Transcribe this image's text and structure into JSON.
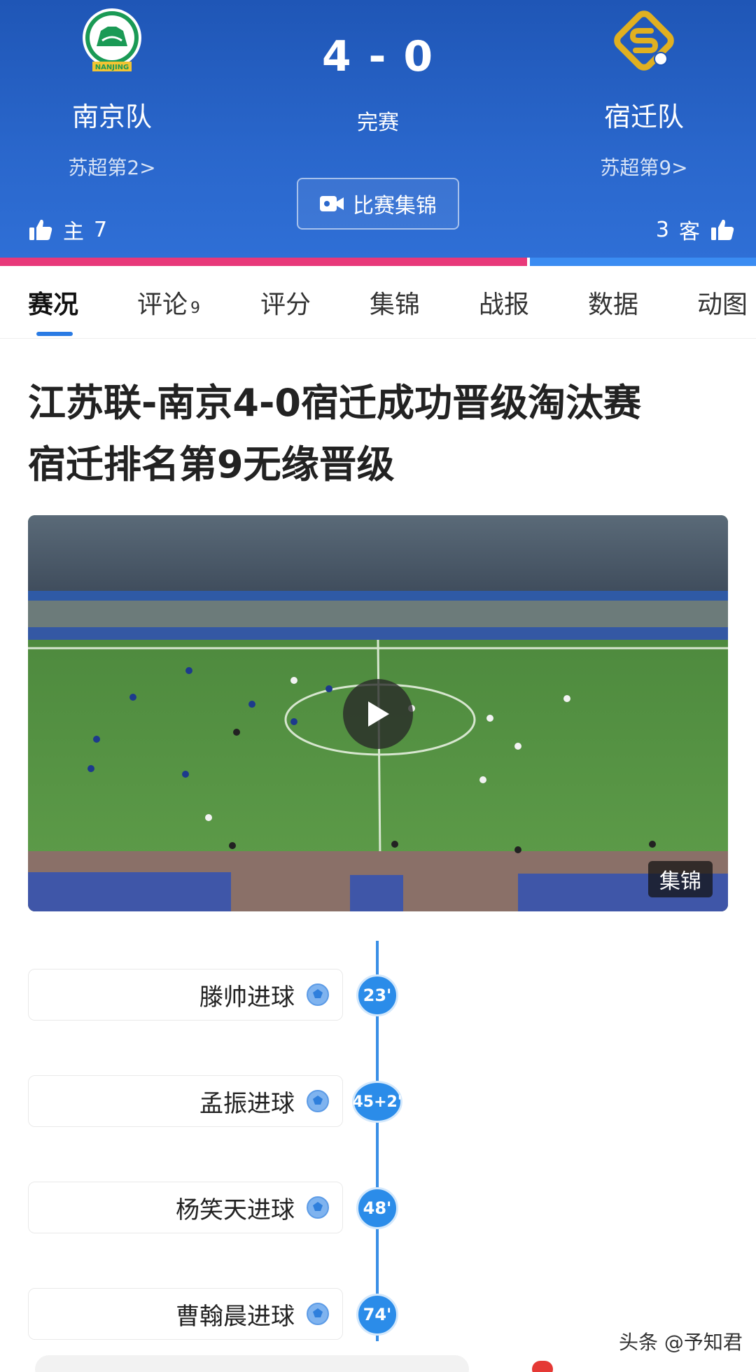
{
  "match": {
    "home": {
      "name": "南京队",
      "rank": "苏超第2>",
      "side": "主",
      "likes": "7",
      "logo_text": "NANJING"
    },
    "away": {
      "name": "宿迁队",
      "rank": "苏超第9>",
      "side": "客",
      "likes": "3"
    },
    "score": "4 - 0",
    "status": "完赛",
    "highlight_button": "比赛集锦",
    "support_split": {
      "home_fraction": 0.7,
      "away_fraction": 0.3
    }
  },
  "tabs": [
    {
      "label": "赛况",
      "count": ""
    },
    {
      "label": "评论",
      "count": "9"
    },
    {
      "label": "评分",
      "count": ""
    },
    {
      "label": "集锦",
      "count": ""
    },
    {
      "label": "战报",
      "count": ""
    },
    {
      "label": "数据",
      "count": ""
    },
    {
      "label": "动图",
      "count": ""
    }
  ],
  "article": {
    "headline_line1": "江苏联-南京4-0宿迁成功晋级淘汰赛",
    "headline_line2": "宿迁排名第9无缘晋级"
  },
  "video": {
    "tag": "集锦"
  },
  "events": [
    {
      "text": "滕帅进球",
      "minute": "23'"
    },
    {
      "text": "孟振进球",
      "minute": "45+2'"
    },
    {
      "text": "杨笑天进球",
      "minute": "48'"
    },
    {
      "text": "曹翰晨进球",
      "minute": "74'"
    }
  ],
  "footer": {
    "watermark": "头条 @予知君"
  },
  "colors": {
    "header_bg": "#2a67cc",
    "home_bar": "#e8397a",
    "away_bar": "#3b8cf2",
    "accent": "#2b8ce9"
  },
  "icons": [
    "nanjing-logo-icon",
    "suqian-logo-icon",
    "thumbs-up-icon",
    "video-camera-icon",
    "play-icon",
    "soccer-ball-icon"
  ]
}
